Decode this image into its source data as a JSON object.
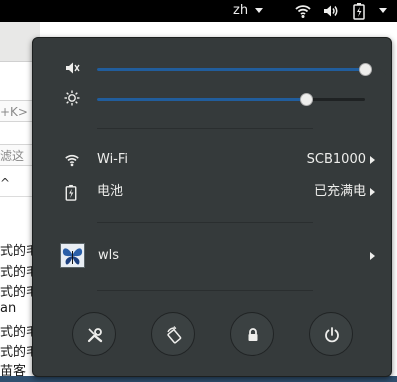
{
  "top_panel": {
    "language": "zh",
    "icons": [
      "wifi-icon",
      "volume-icon",
      "battery-icon"
    ]
  },
  "background_app": {
    "field1_text": "+K>",
    "field2_text": "滤这",
    "caret_text": "^",
    "lines": [
      "式的毛",
      "式的毛",
      "式的毛",
      "an",
      "式的毛",
      "式的毛",
      "苗客"
    ]
  },
  "system_menu": {
    "volume": {
      "icon": "speaker-icon",
      "level": 1.0
    },
    "brightness": {
      "icon": "brightness-icon",
      "level": 0.78
    },
    "rows": [
      {
        "icon": "wifi-icon",
        "label": "Wi-Fi",
        "value": "SCB1000"
      },
      {
        "icon": "battery-icon",
        "label": "电池",
        "value": "已充满电"
      }
    ],
    "user": {
      "icon": "butterfly-avatar",
      "name": "wls"
    },
    "actions": [
      {
        "name": "settings",
        "icon": "tools-icon"
      },
      {
        "name": "rotation-lock",
        "icon": "rotation-icon"
      },
      {
        "name": "lock",
        "icon": "lock-icon"
      },
      {
        "name": "power",
        "icon": "power-icon"
      }
    ],
    "accent_color": "#215d9c"
  }
}
